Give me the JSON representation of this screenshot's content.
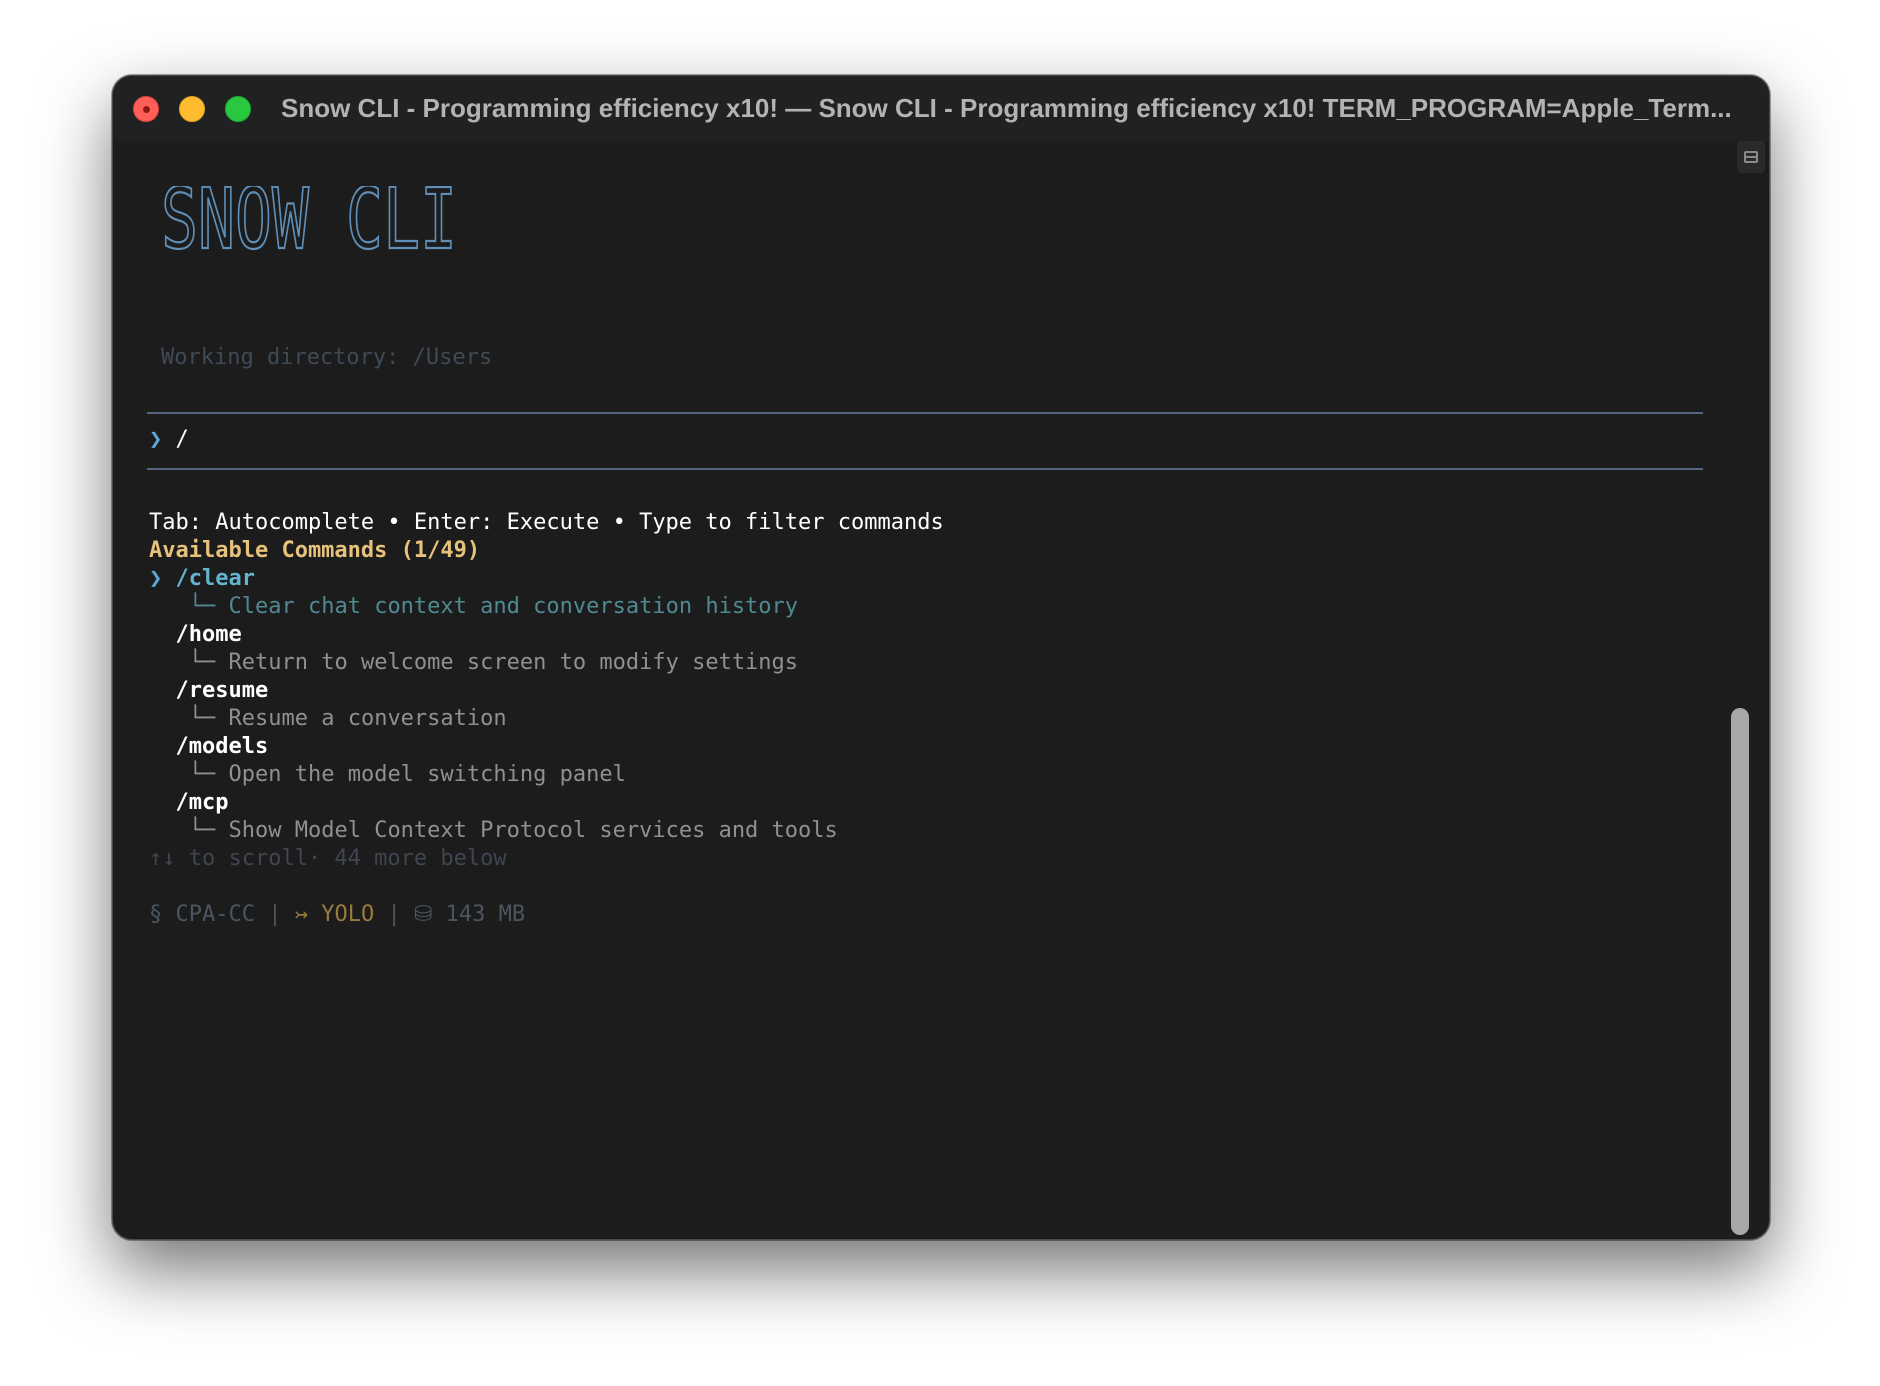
{
  "window": {
    "title": "Snow CLI - Programming efficiency x10! — Snow CLI - Programming efficiency x10! TERM_PROGRAM=Apple_Term..."
  },
  "header": {
    "logo_text": "SNOW CLI",
    "working_directory": "Working directory: /Users"
  },
  "input": {
    "prompt_symbol": "❯",
    "value": "/"
  },
  "help": {
    "hint": "Tab: Autocomplete • Enter: Execute • Type to filter commands",
    "available_label": "Available Commands (1/49)"
  },
  "commands": [
    {
      "selector": "❯",
      "name": "/clear",
      "branch": "└─",
      "description": "Clear chat context and conversation history",
      "selected": true
    },
    {
      "selector": "",
      "name": "/home",
      "branch": "└─",
      "description": "Return to welcome screen to modify settings",
      "selected": false
    },
    {
      "selector": "",
      "name": "/resume",
      "branch": "└─",
      "description": "Resume a conversation",
      "selected": false
    },
    {
      "selector": "",
      "name": "/models",
      "branch": "└─",
      "description": "Open the model switching panel",
      "selected": false
    },
    {
      "selector": "",
      "name": "/mcp",
      "branch": "└─",
      "description": "Show Model Context Protocol services and tools",
      "selected": false
    }
  ],
  "scroll_hint": "↑↓ to scroll· 44 more below",
  "status": {
    "profile_icon": "§",
    "profile": "CPA-CC",
    "sep1": "|",
    "mode_icon": "↣",
    "mode": "YOLO",
    "sep2": "|",
    "memory_icon": "⛁",
    "memory": "143 MB"
  },
  "colors": {
    "background": "#1c1c1c",
    "logo": "#5f8fb8",
    "accent_gold": "#e6c27a",
    "selected_command": "#63b4cf",
    "rule": "#55657e"
  }
}
